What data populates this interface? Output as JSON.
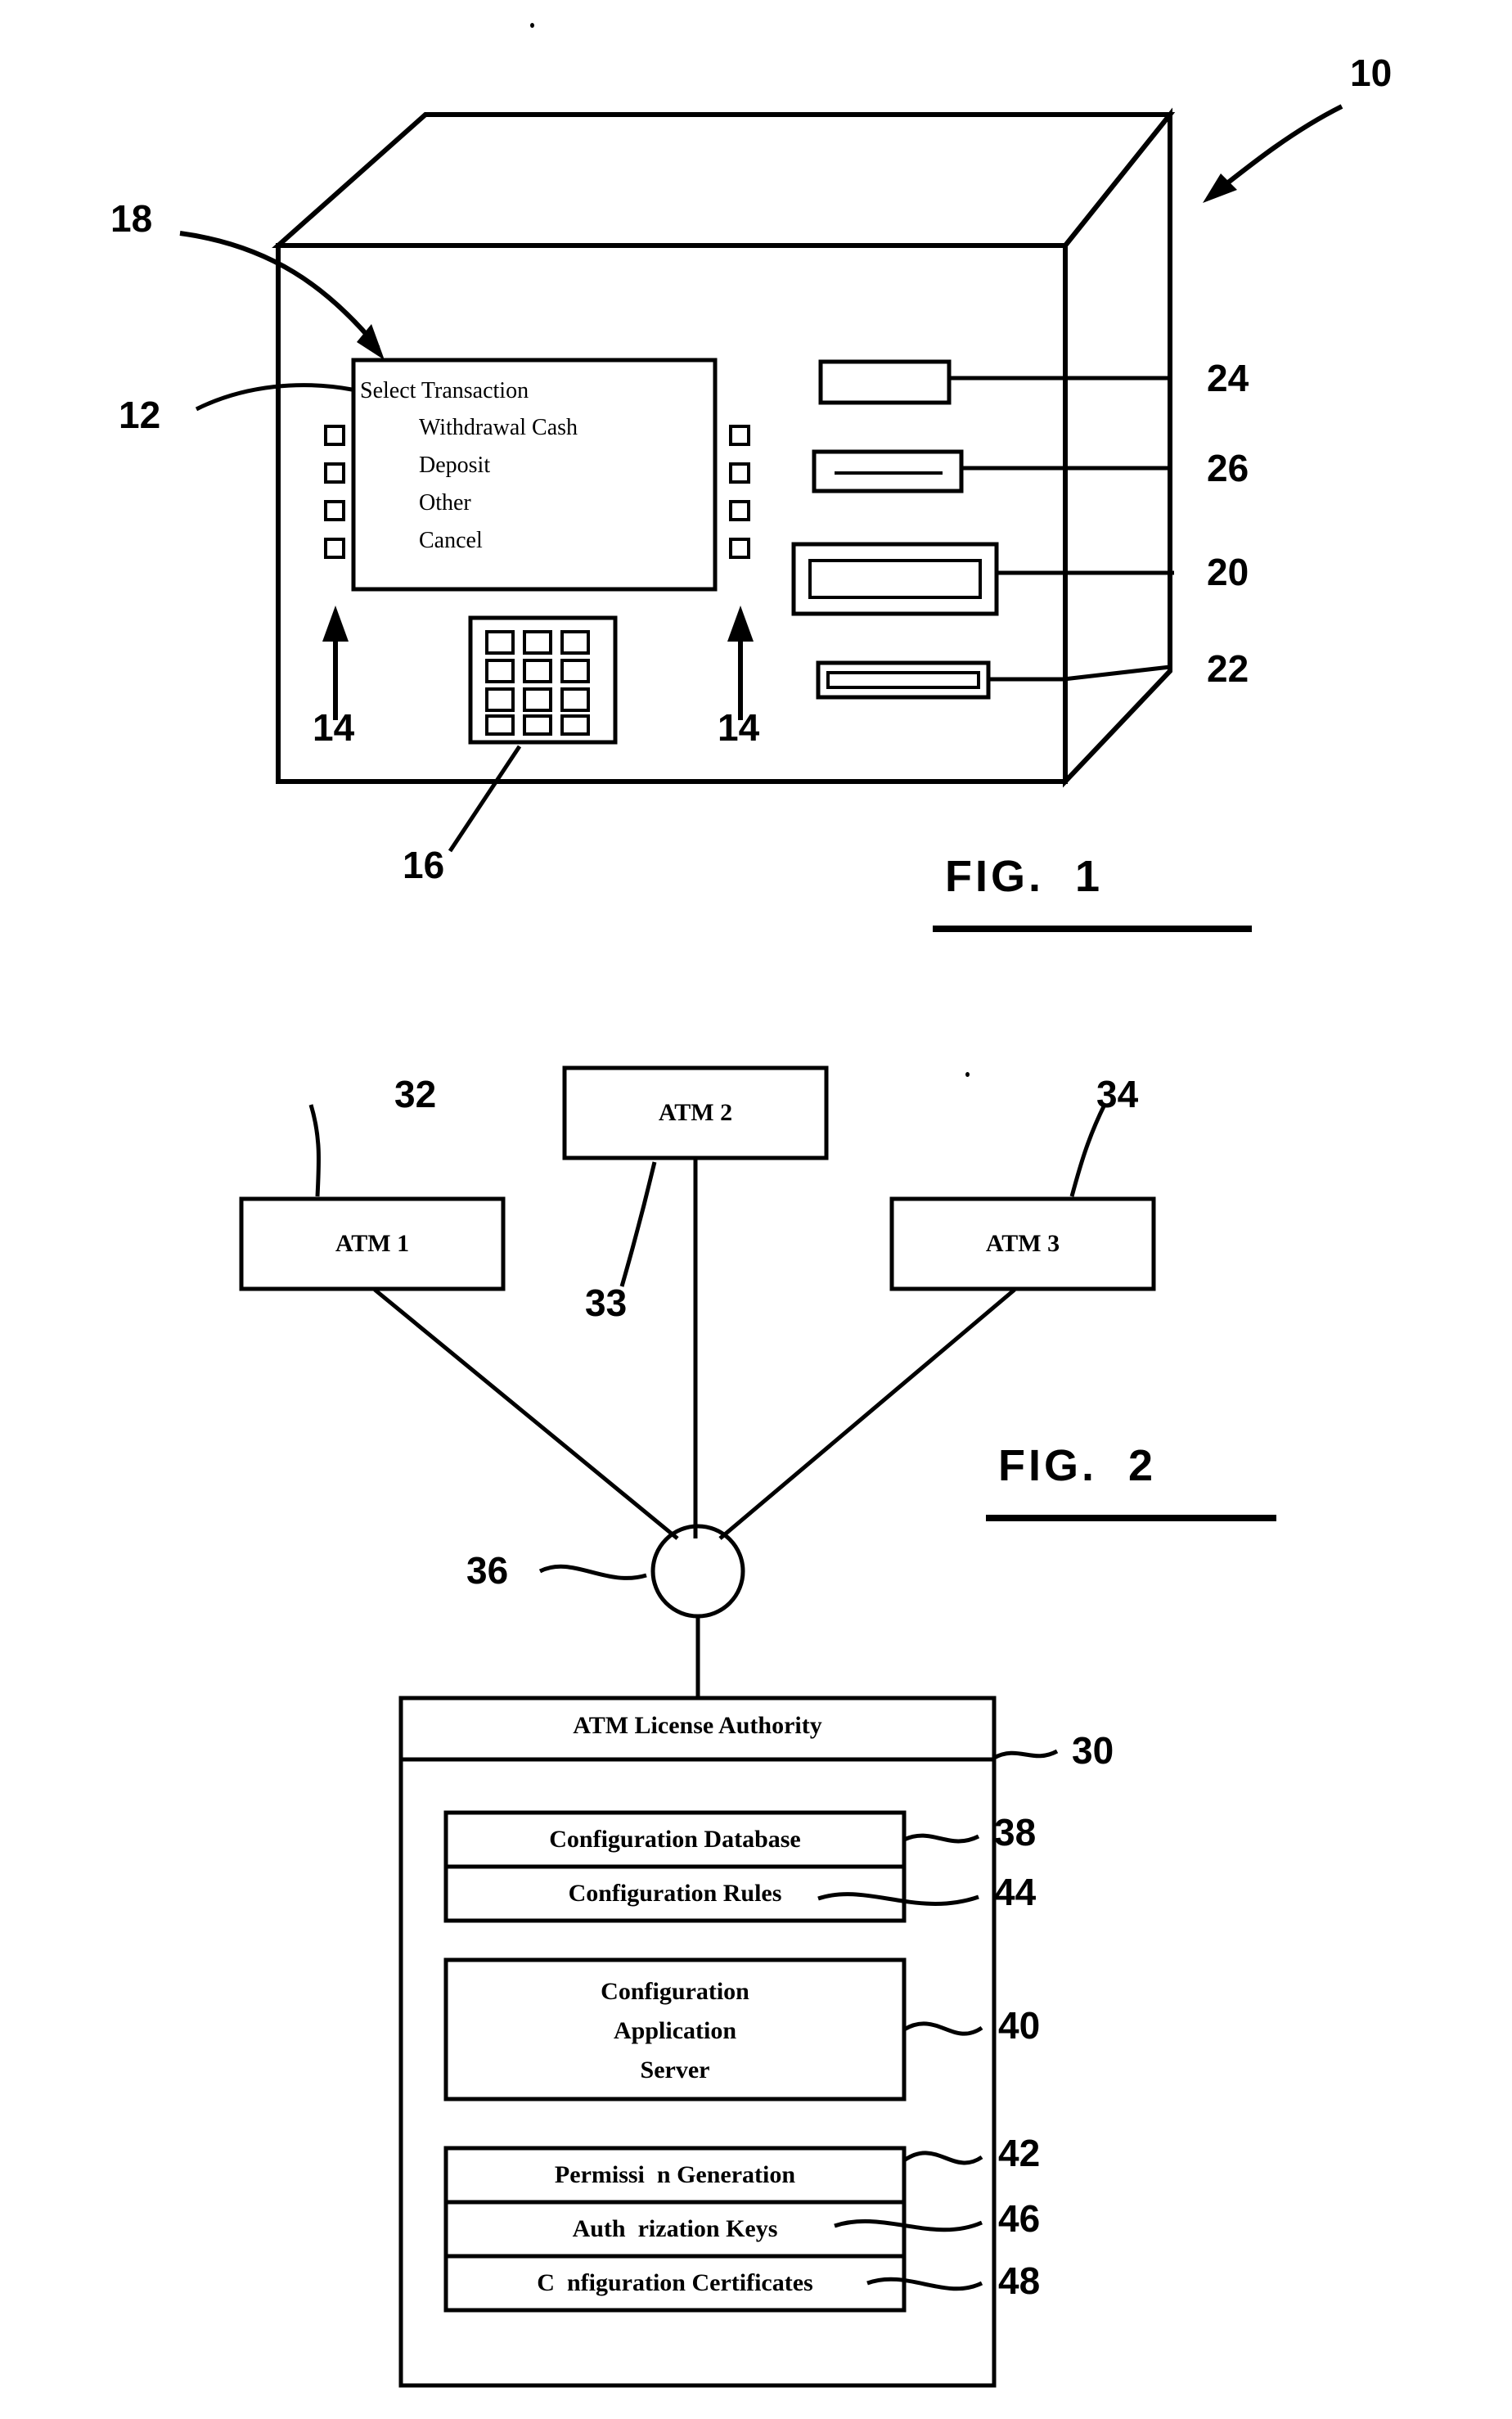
{
  "document": {
    "type": "patent-drawing-sheet",
    "figures": [
      {
        "id": "fig1",
        "caption": "FIG.  1",
        "title": "Automated Teller Machine perspective view",
        "screen": {
          "header": "Select Transaction",
          "options": [
            "Withdrawal Cash",
            "Deposit",
            "Other",
            "Cancel"
          ]
        },
        "reference_numerals": [
          {
            "id": "10",
            "label": "10",
            "target": "atm-cabinet"
          },
          {
            "id": "18",
            "label": "18",
            "target": "screen-header"
          },
          {
            "id": "12",
            "label": "12",
            "target": "display-screen"
          },
          {
            "id": "14a",
            "label": "14",
            "target": "left-function-keys"
          },
          {
            "id": "14b",
            "label": "14",
            "target": "right-function-keys"
          },
          {
            "id": "16",
            "label": "16",
            "target": "keypad"
          },
          {
            "id": "24",
            "label": "24",
            "target": "receipt-slot"
          },
          {
            "id": "26",
            "label": "26",
            "target": "card-reader"
          },
          {
            "id": "20",
            "label": "20",
            "target": "cash-dispenser"
          },
          {
            "id": "22",
            "label": "22",
            "target": "deposit-slot"
          }
        ]
      },
      {
        "id": "fig2",
        "caption": "FIG.  2",
        "title": "ATM network with license authority",
        "nodes": [
          {
            "id": "atm1",
            "label": "ATM 1",
            "numeral": "32"
          },
          {
            "id": "atm2",
            "label": "ATM 2",
            "numeral": "33"
          },
          {
            "id": "atm3",
            "label": "ATM 3",
            "numeral": "34"
          },
          {
            "id": "hub",
            "label": "",
            "numeral": "36"
          },
          {
            "id": "authority",
            "label": "ATM License Authority",
            "numeral": "30"
          },
          {
            "id": "configdb",
            "label": "Configuration Database",
            "numeral": "38"
          },
          {
            "id": "configrules",
            "label": "Configuration Rules",
            "numeral": "44"
          },
          {
            "id": "appserver",
            "label": "Configuration\nApplication\nServer",
            "numeral": "40"
          },
          {
            "id": "permission",
            "label": "Permissi  n Generation",
            "numeral": "42"
          },
          {
            "id": "authkeys",
            "label": "Auth  rization Keys",
            "numeral": "46"
          },
          {
            "id": "certs",
            "label": "C  nfiguration Certificates",
            "numeral": "48"
          }
        ]
      }
    ]
  },
  "colors": {
    "ink": "#000000",
    "paper": "#ffffff"
  }
}
